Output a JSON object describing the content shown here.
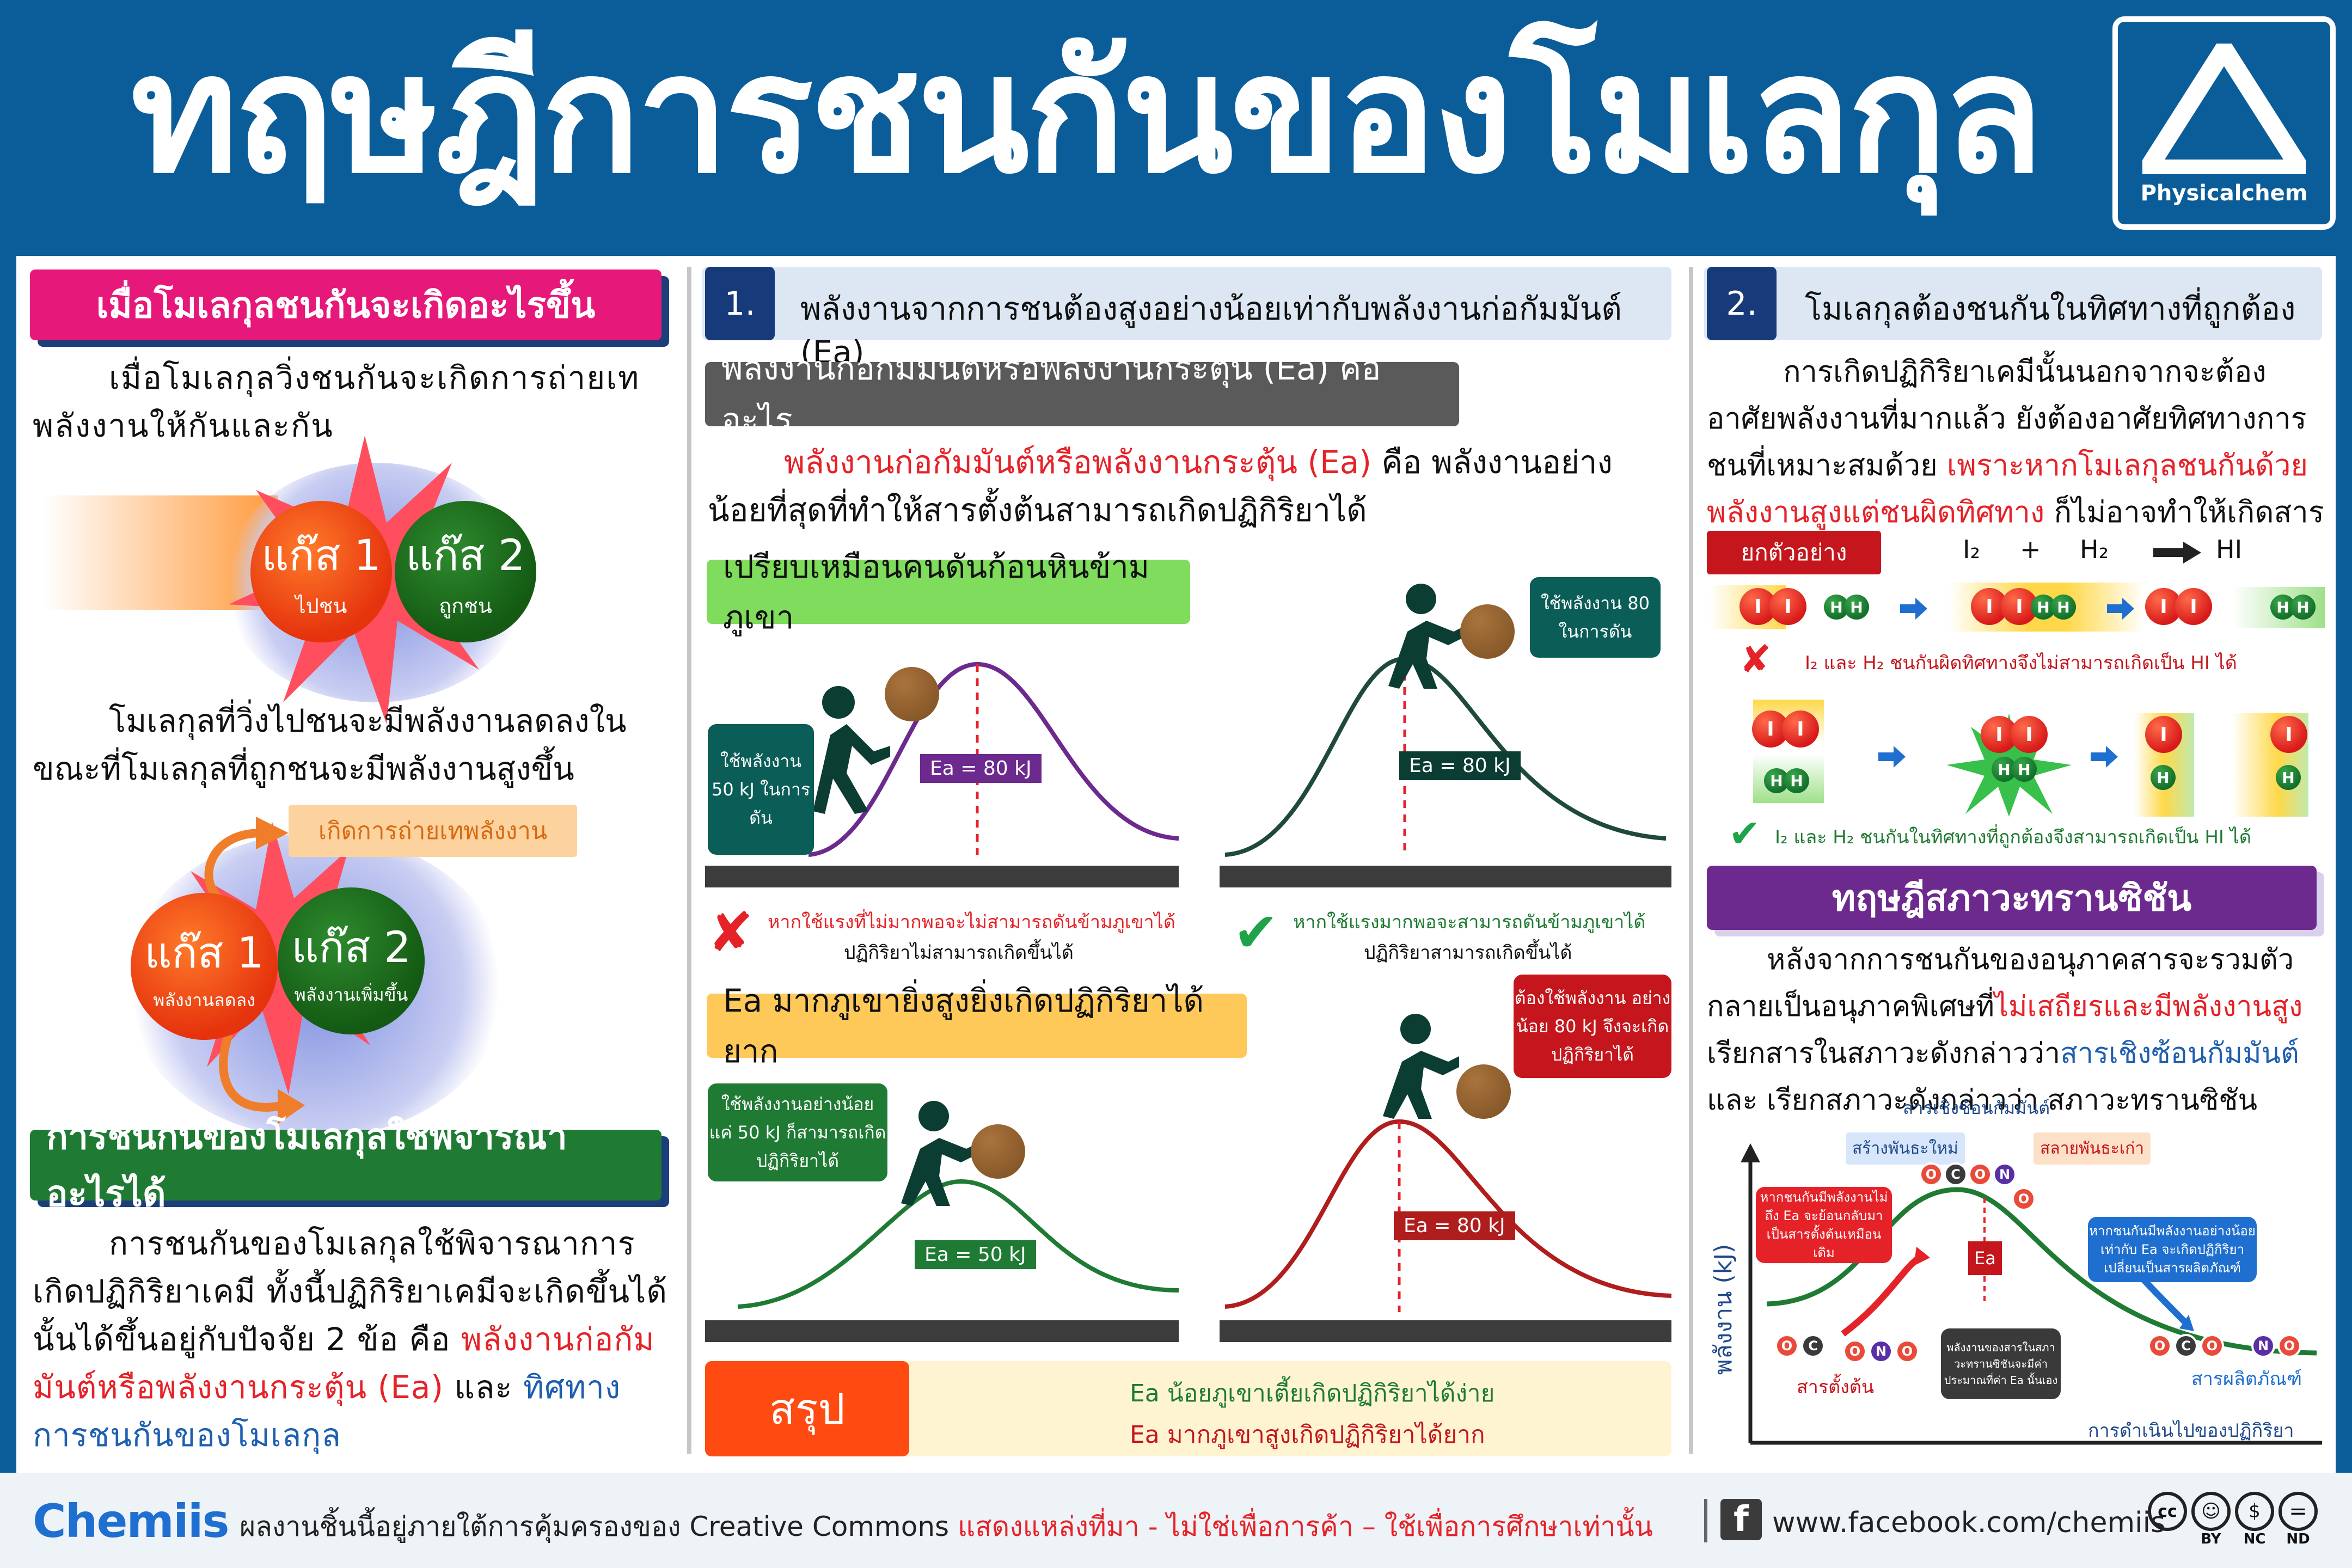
{
  "header": {
    "title": "ทฤษฎีการชนกันของโมเลกุล",
    "brand": "Physicalchem"
  },
  "left": {
    "h1": "เมื่อโมเลกุลชนกันจะเกิดอะไรขึ้น",
    "p1": "เมื่อโมเลกุลวิ่งชนกันจะเกิดการถ่ายเทพลังงานให้กันและกัน",
    "gas1": {
      "name": "แก๊ส 1",
      "sub": "ไปชน"
    },
    "gas2": {
      "name": "แก๊ส 2",
      "sub": "ถูกชน"
    },
    "p2": "โมเลกุลที่วิ่งไปชนจะมีพลังงานลดลงในขณะที่โมเลกุลที่ถูกชนจะมีพลังงานสูงขึ้น",
    "transfer": "เกิดการถ่ายเทพลังงาน",
    "gas1b": {
      "name": "แก๊ส 1",
      "sub": "พลังงานลดลง"
    },
    "gas2b": {
      "name": "แก๊ส 2",
      "sub": "พลังงานเพิ่มขึ้น"
    },
    "h2": "การชนกันของโมเลกุลใช้พิจารณาอะไรได้",
    "p3a": "การชนกันของโมเลกุลใช้พิจารณาการเกิดปฏิกิริยาเคมี ทั้งนี้ปฏิกิริยาเคมีจะเกิดขึ้นได้นั้นได้ขึ้นอยู่กับปัจจัย 2 ข้อ คือ ",
    "p3b": "พลังงานก่อกัมมันต์หรือพลังงานกระตุ้น (Ea)",
    "p3c": " และ ",
    "p3d": "ทิศทางการชนกันของโมเลกุล"
  },
  "middle": {
    "num": "1.",
    "title": "พลังงานจากการชนต้องสูงอย่างน้อยเท่ากับพลังงานก่อกัมมันต์ (Ea)",
    "sub": "พลังงานก่อกัมมันต์หรือพลังงานกระตุ้น (Ea) คืออะไร",
    "p1a": "พลังงานก่อกัมมันต์หรือพลังงานกระตุ้น (Ea)",
    "p1b": " คือ พลังงานอย่างน้อยที่สุดที่ทำให้สารตั้งต้นสามารถเกิดปฏิกิริยาได้",
    "compare": "เปรียบเหมือนคนดันก้อนหินข้ามภูเขา",
    "b1": {
      "note": "ใช้พลังงาน 50 kJ ในการดัน",
      "ea": "Ea = 80 kJ"
    },
    "b2": {
      "note": "ใช้พลังงาน 80 ในการดัน",
      "ea": "Ea = 80 kJ"
    },
    "fail1": "หากใช้แรงที่ไม่มากพอจะไม่สามารถดันข้ามภูเขาได้",
    "fail2": "ปฏิกิริยาไม่สามารถเกิดขึ้นได้",
    "ok1": "หากใช้แรงมากพอจะสามารถดันข้ามภูเขาได้",
    "ok2": "ปฏิกิริยาสามารถเกิดขึ้นได้",
    "ea_title": "Ea มากภูเขายิ่งสูงยิ่งเกิดปฏิกิริยาได้ยาก",
    "b3": {
      "note": "ใช้พลังงานอย่างน้อย แค่ 50 kJ ก็สามารถเกิดปฏิกิริยาได้",
      "ea": "Ea = 50 kJ"
    },
    "b4": {
      "note": "ต้องใช้พลังงาน อย่างน้อย 80 kJ จึงจะเกิดปฏิกิริยาได้",
      "ea": "Ea = 80 kJ"
    },
    "sum_label": "สรุป",
    "sum1": "Ea น้อยภูเขาเตี้ยเกิดปฏิกิริยาได้ง่าย",
    "sum2": "Ea มากภูเขาสูงเกิดปฏิกิริยาได้ยาก"
  },
  "right": {
    "num": "2.",
    "title": "โมเลกุลต้องชนกันในทิศทางที่ถูกต้อง",
    "p1a": "การเกิดปฏิกิริยาเคมีนั้นนอกจากจะต้องอาศัยพลังงานที่มากแล้ว ยังต้องอาศัยทิศทางการชนที่เหมาะสมด้วย ",
    "p1b": "เพราะหากโมเลกุลชนกันด้วยพลังงานสูงแต่ชนผิดทิศทาง",
    "p1c": " ก็ไม่อาจทำให้เกิดสารผลิตภัณฑ์ได้",
    "example": "ยกตัวอย่าง",
    "eq": {
      "r1": "I₂",
      "plus": "+",
      "r2": "H₂",
      "prod": "HI"
    },
    "wrong": "I₂ และ H₂ ชนกันผิดทิศทางจึงไม่สามารถเกิดเป็น HI ได้",
    "right_dir": "I₂ และ H₂ ชนกันในทิศทางที่ถูกต้องจึงสามารถเกิดเป็น HI ได้",
    "ts_title": "ทฤษฎีสภาวะทรานซิชัน",
    "p2a": "หลังจากการชนกันของอนุภาคสารจะรวมตัวกลายเป็นอนุภาคพิเศษที่",
    "p2b": "ไม่เสถียรและมีพลังงานสูง",
    "p2c": " เรียกสารในสภาวะดังกล่าวว่า",
    "p2d": "สารเชิงซ้อนกัมมันต์",
    "p2e": " และ เรียกสภาวะดังกล่าวว่า สภาวะทรานซิชัน",
    "graph": {
      "complex": "สารเชิงซ้อนกัมมันต์",
      "new_bond": "สร้างพันธะใหม่",
      "break_bond": "สลายพันธะเก่า",
      "low_note": "หากชนกันมีพลังงานไม่ถึง Ea จะย้อนกลับมาเป็นสารตั้งต้นเหมือนเดิม",
      "high_note": "หากชนกันมีพลังงานอย่างน้อยเท่ากับ Ea จะเกิดปฏิกิริยาเปลี่ยนเป็นสารผลิตภัณฑ์",
      "ea": "Ea",
      "ts_note": "พลังงานของสารในสภาวะทรานซิชันจะมีค่าประมาณที่ค่า Ea นั้นเอง",
      "reactant": "สารตั้งต้น",
      "product": "สารผลิตภัณฑ์",
      "ylabel": "พลังงาน (kJ)",
      "xlabel": "การดำเนินไปของปฏิกิริยา"
    }
  },
  "footer": {
    "logo": "Chemiis",
    "text1": "ผลงานชิ้นนี้อยู่ภายใต้การคุ้มครองของ Creative Commons ",
    "text2": "แสดงแหล่งที่มา - ไม่ใช่เพื่อการค้า – ใช้เพื่อการศึกษาเท่านั้น",
    "fb": "www.facebook.com/chemiis",
    "cc": [
      "BY",
      "NC",
      "ND"
    ]
  },
  "colors": {
    "header": "#0b5d9a",
    "red": "#e52228",
    "green": "#1f7a34",
    "purple": "#6d2a8e",
    "navy": "#173b7a"
  }
}
